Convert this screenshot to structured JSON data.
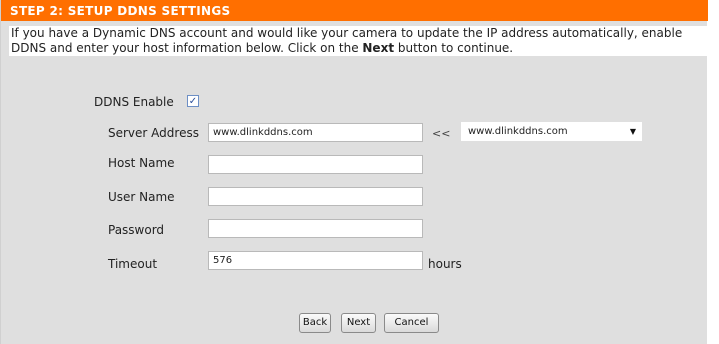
{
  "header": {
    "title": "STEP 2: SETUP DDNS SETTINGS"
  },
  "intro": {
    "text_before": "If you have a Dynamic DNS account and would like your camera to update the IP address automatically, enable DDNS and enter your host information below. Click on the ",
    "bold": "Next",
    "text_after": " button to continue."
  },
  "ddns_enable": {
    "label": "DDNS Enable",
    "checked": true,
    "check_glyph": "✓"
  },
  "server_address": {
    "label": "Server Address",
    "value": "www.dlinkddns.com",
    "arrows": "<<",
    "select_value": "www.dlinkddns.com"
  },
  "host_name": {
    "label": "Host Name",
    "value": ""
  },
  "user_name": {
    "label": "User Name",
    "value": ""
  },
  "password": {
    "label": "Password",
    "value": ""
  },
  "timeout": {
    "label": "Timeout",
    "value": "576",
    "unit": "hours"
  },
  "buttons": {
    "back": "Back",
    "next": "Next",
    "cancel": "Cancel"
  }
}
